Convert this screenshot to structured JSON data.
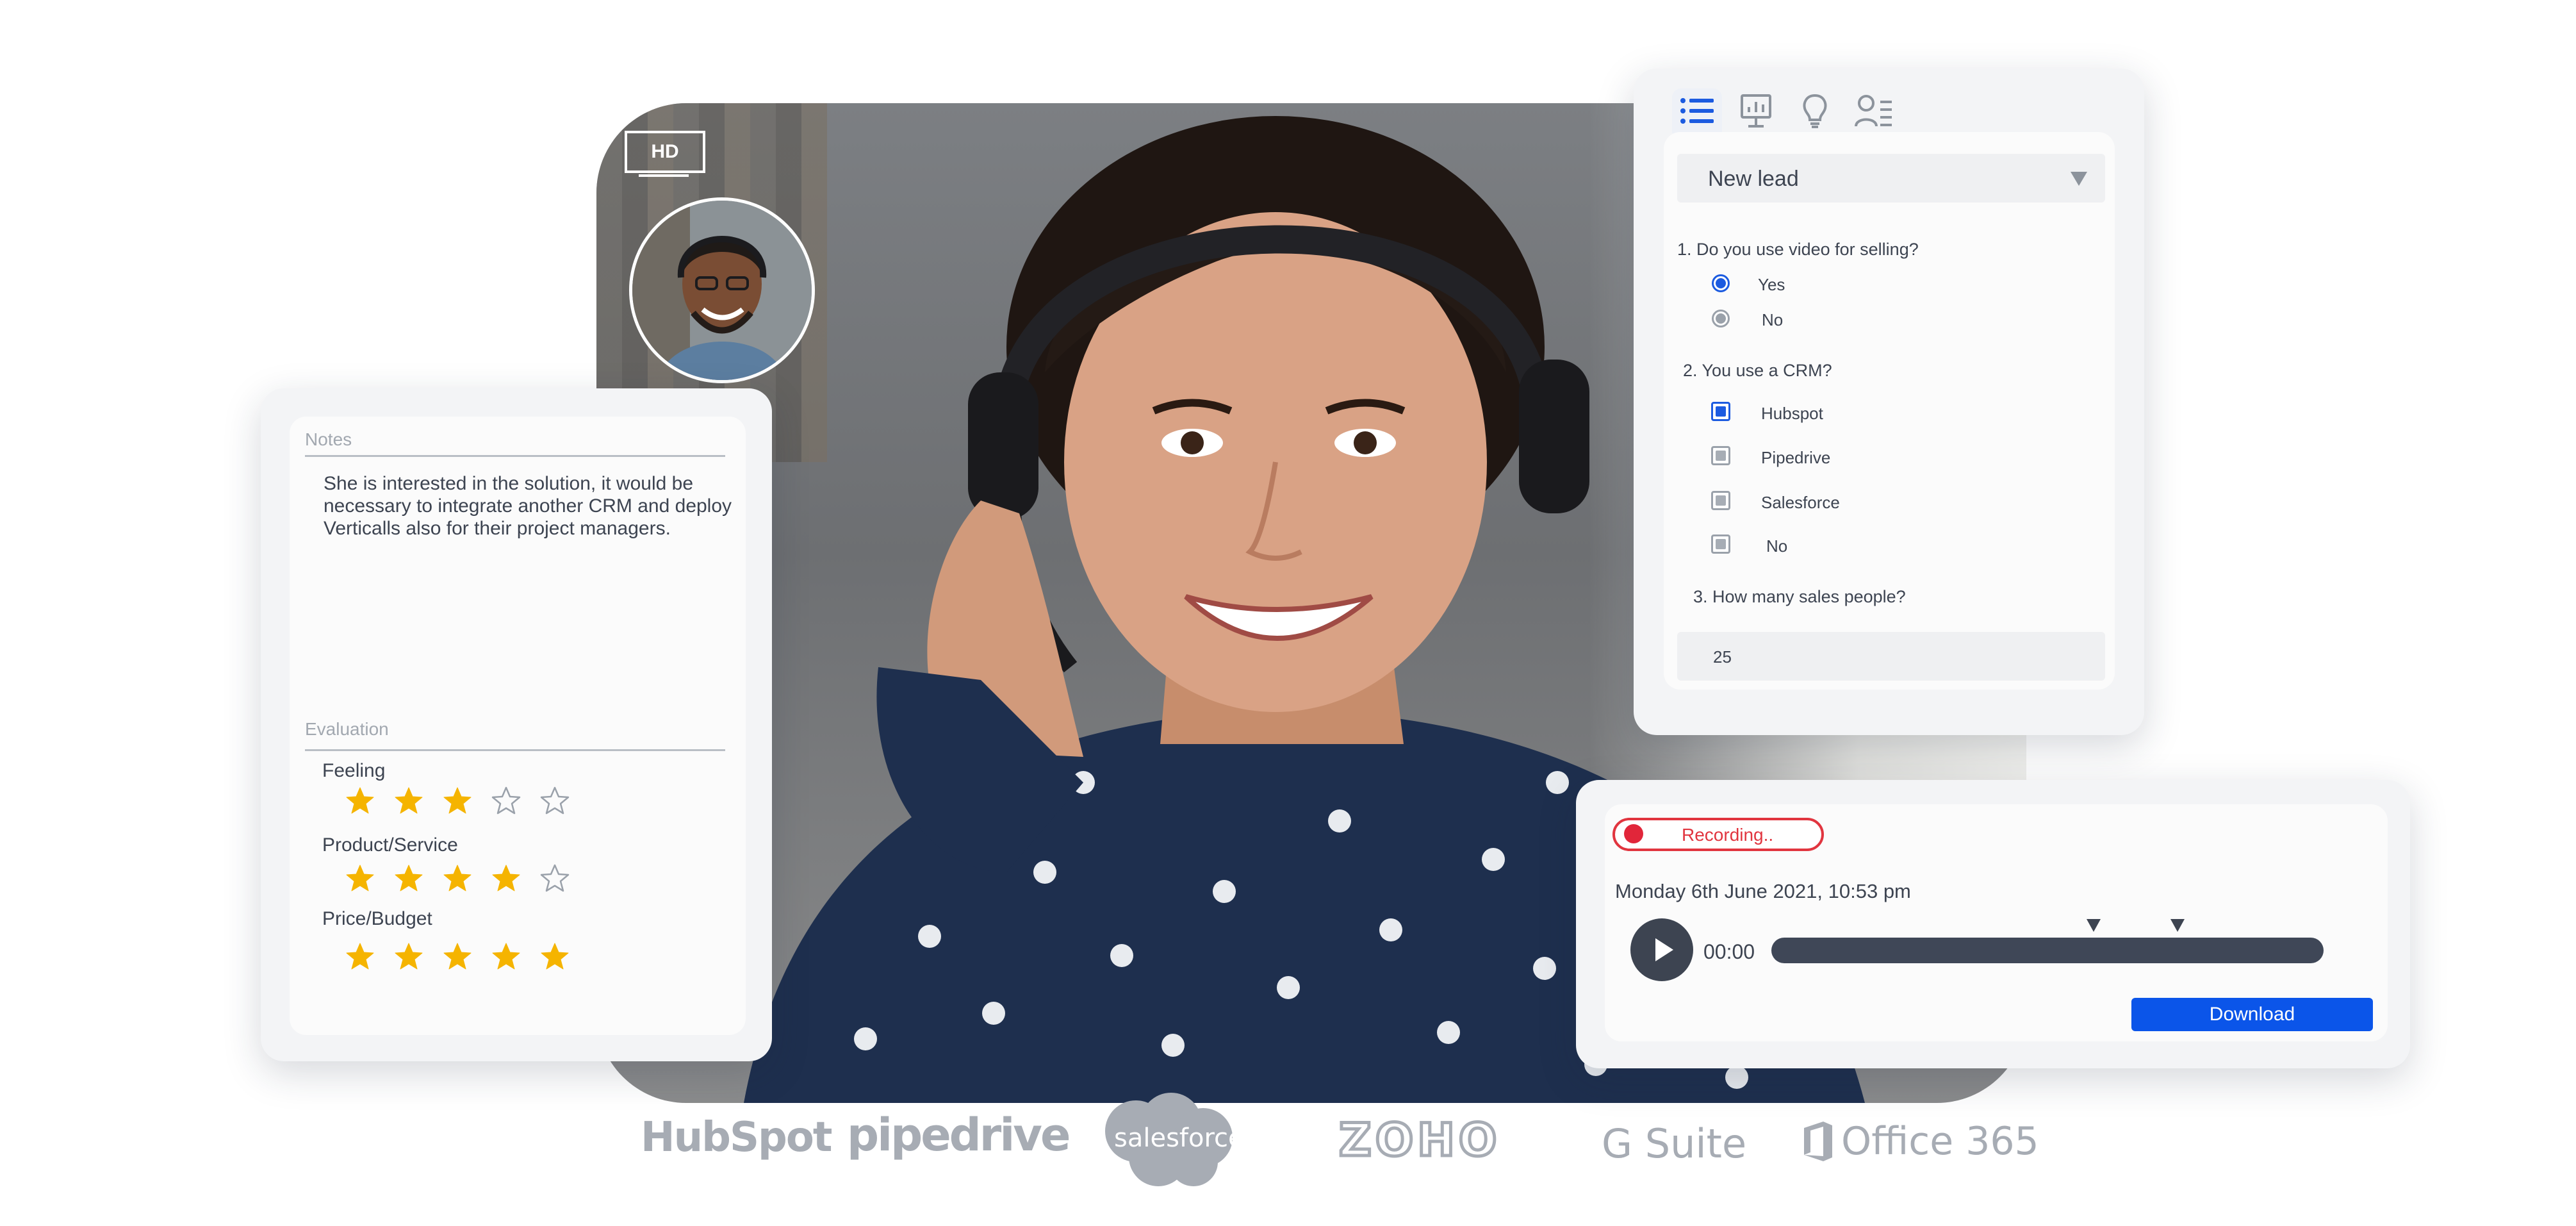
{
  "video": {
    "quality_badge": "HD"
  },
  "notes": {
    "label": "Notes",
    "text": "She is interested in the solution, it would be necessary to integrate another CRM and deploy Verticalls also for their project managers.",
    "evaluation_label": "Evaluation",
    "criteria": [
      {
        "label": "Feeling",
        "rating": 3,
        "max": 5
      },
      {
        "label": "Product/Service",
        "rating": 4,
        "max": 5
      },
      {
        "label": "Price/Budget",
        "rating": 5,
        "max": 5
      }
    ]
  },
  "form": {
    "tabs": [
      {
        "icon": "list-icon",
        "active": true
      },
      {
        "icon": "presentation-icon",
        "active": false
      },
      {
        "icon": "lightbulb-icon",
        "active": false
      },
      {
        "icon": "user-list-icon",
        "active": false
      }
    ],
    "lead_select": "New lead",
    "q1": {
      "text": "1. Do you use video for selling?",
      "options": [
        {
          "label": "Yes",
          "selected": true
        },
        {
          "label": "No",
          "selected": false
        }
      ]
    },
    "q2": {
      "text": "2. You use a CRM?",
      "options": [
        {
          "label": "Hubspot",
          "checked": true
        },
        {
          "label": "Pipedrive",
          "checked": false
        },
        {
          "label": "Salesforce",
          "checked": false
        },
        {
          "label": "No",
          "checked": false
        }
      ]
    },
    "q3": {
      "text": "3. How many sales people?",
      "value": "25"
    }
  },
  "recording": {
    "status": "Recording..",
    "date": "Monday 6th June 2021, 10:53 pm",
    "time": "00:00",
    "download_label": "Download"
  },
  "integrations": [
    "HubSpot",
    "pipedrive",
    "salesforce",
    "ZOHO",
    "G Suite",
    "Office 365"
  ],
  "colors": {
    "accent_blue": "#0b55e9",
    "record_red": "#e1353f",
    "star_gold": "#f5b400",
    "text_dark": "#3d4451"
  }
}
